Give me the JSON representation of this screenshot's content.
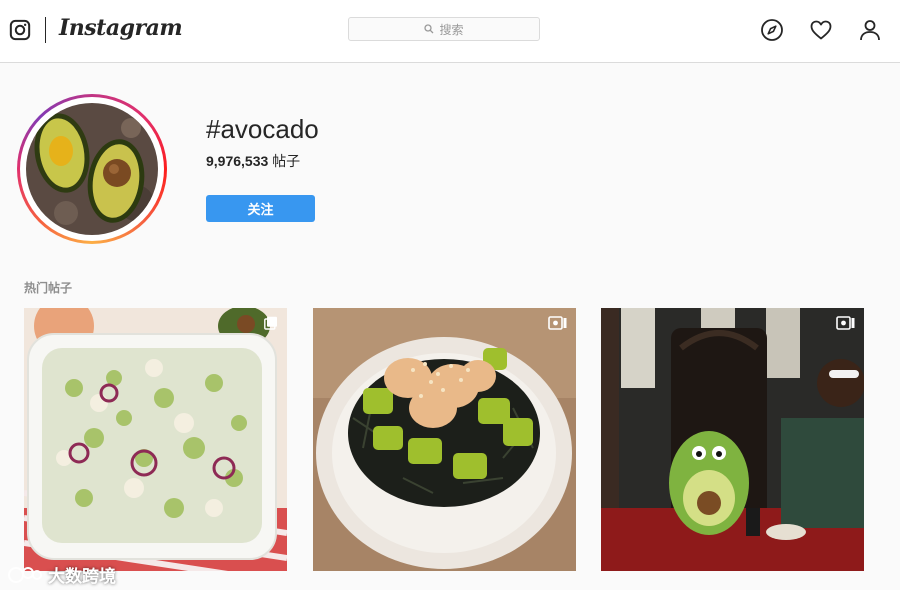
{
  "nav": {
    "brand": "Instagram",
    "search_placeholder": "搜索",
    "icons": [
      "instagram-camera-icon",
      "search-icon",
      "compass-icon",
      "heart-icon",
      "profile-icon"
    ]
  },
  "profile": {
    "hashtag": "#avocado",
    "post_count": "9,976,533",
    "post_label": "帖子",
    "follow_label": "关注"
  },
  "section": {
    "title": "热门帖子"
  },
  "posts": [
    {
      "kind": "multi-image",
      "badge_icon": "multiple-posts-icon"
    },
    {
      "kind": "video",
      "badge_icon": "video-icon"
    },
    {
      "kind": "video",
      "badge_icon": "video-icon"
    }
  ],
  "watermark": {
    "text": "大数跨境"
  },
  "colors": {
    "accent": "#3897f0",
    "text": "#262626",
    "muted": "#8e8e8e",
    "border": "#dbdbdb"
  }
}
